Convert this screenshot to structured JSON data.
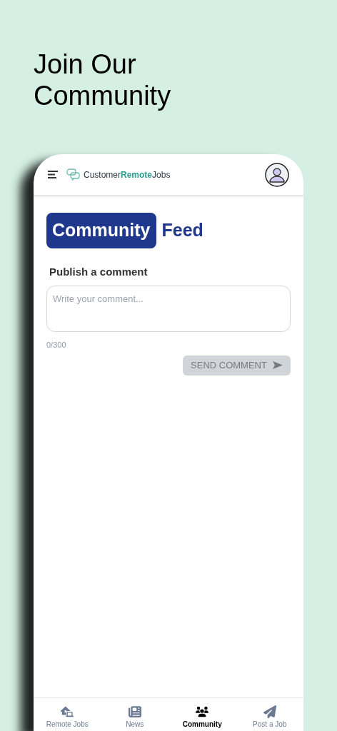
{
  "headline": "Join Our Community",
  "app_bar": {
    "logo": "Customer**Remote**Jobs"
  },
  "title": {
    "highlight": "Community",
    "rest": "Feed"
  },
  "comment_form": {
    "label": "Publish a comment",
    "placeholder": "Write your comment...",
    "counter": "0/300",
    "button": "SEND COMMENT",
    "disabled": true
  },
  "bottom_nav": [
    {
      "label": "Remote Jobs",
      "kind": "jobs",
      "selected": false
    },
    {
      "label": "News",
      "kind": "news",
      "selected": false
    },
    {
      "label": "Community",
      "kind": "community",
      "selected": true
    },
    {
      "label": "Post a Job",
      "kind": "post",
      "selected": false
    }
  ]
}
